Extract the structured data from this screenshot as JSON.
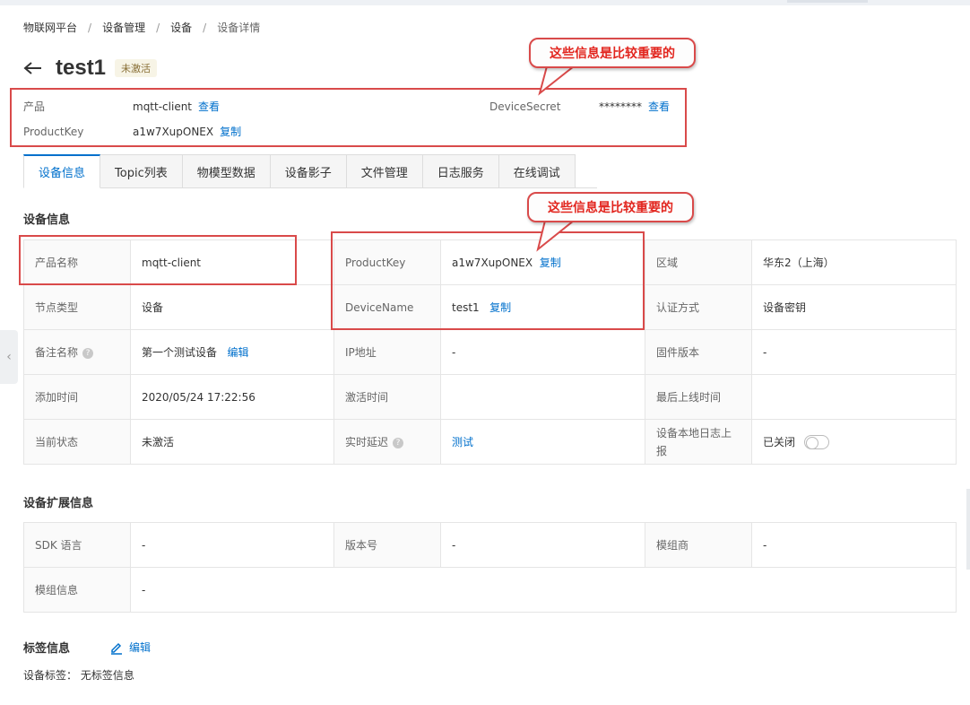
{
  "breadcrumb": [
    "物联网平台",
    "设备管理",
    "设备",
    "设备详情"
  ],
  "breadcrumb_sep": "/",
  "device": {
    "name": "test1",
    "status": "未激活"
  },
  "summary": {
    "product_label": "产品",
    "product_value": "mqtt-client",
    "product_link": "查看",
    "productkey_label": "ProductKey",
    "productkey_value": "a1w7XupONEX",
    "productkey_link": "复制",
    "secret_label": "DeviceSecret",
    "secret_value": "********",
    "secret_link": "查看"
  },
  "tabs": [
    "设备信息",
    "Topic列表",
    "物模型数据",
    "设备影子",
    "文件管理",
    "日志服务",
    "在线调试"
  ],
  "callouts": {
    "top": "这些信息是比较重要的",
    "middle": "这些信息是比较重要的"
  },
  "device_info": {
    "title": "设备信息",
    "product_name_label": "产品名称",
    "product_name_value": "mqtt-client",
    "productkey_label": "ProductKey",
    "productkey_value": "a1w7XupONEX",
    "copy": "复制",
    "region_label": "区域",
    "region_value": "华东2（上海）",
    "node_type_label": "节点类型",
    "node_type_value": "设备",
    "devicename_label": "DeviceName",
    "devicename_value": "test1",
    "auth_label": "认证方式",
    "auth_value": "设备密钥",
    "remark_label": "备注名称",
    "remark_value": "第一个测试设备",
    "edit": "编辑",
    "ip_label": "IP地址",
    "ip_value": "-",
    "firmware_label": "固件版本",
    "firmware_value": "-",
    "added_label": "添加时间",
    "added_value": "2020/05/24 17:22:56",
    "activated_label": "激活时间",
    "activated_value": "",
    "last_online_label": "最后上线时间",
    "last_online_value": "",
    "current_status_label": "当前状态",
    "current_status_value": "未激活",
    "latency_label": "实时延迟",
    "latency_value": "测试",
    "local_log_label": "设备本地日志上报",
    "local_log_value": "已关闭",
    "help_glyph": "?"
  },
  "ext_info": {
    "title": "设备扩展信息",
    "sdk_label": "SDK 语言",
    "sdk_value": "-",
    "version_label": "版本号",
    "version_value": "-",
    "vendor_label": "模组商",
    "vendor_value": "-",
    "module_label": "模组信息",
    "module_value": "-"
  },
  "tags": {
    "title": "标签信息",
    "edit": "编辑",
    "line": "设备标签：  无标签信息"
  },
  "colors": {
    "accent": "#0070cc",
    "annotation": "#d94a4a",
    "callout_text": "#e2261f"
  }
}
